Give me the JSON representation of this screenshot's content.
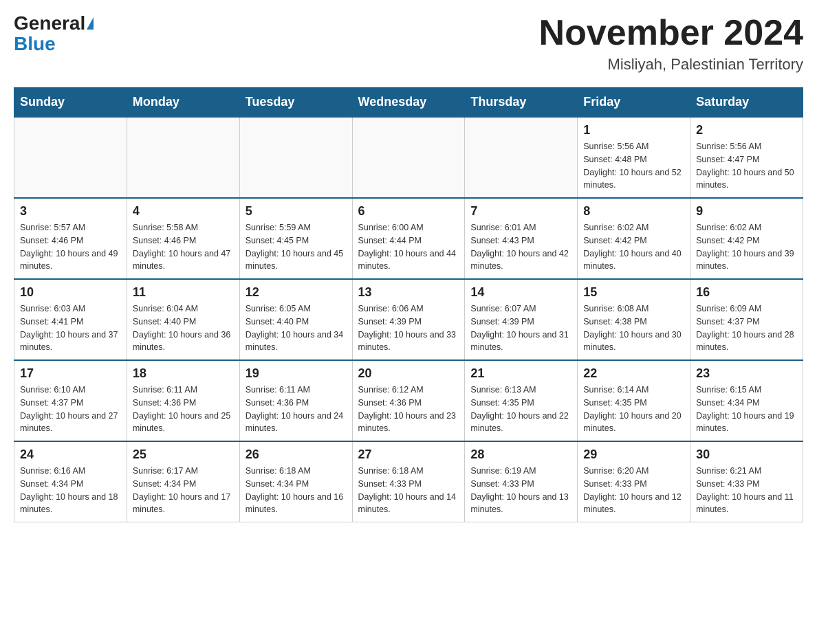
{
  "header": {
    "logo_general": "General",
    "logo_blue": "Blue",
    "title": "November 2024",
    "subtitle": "Misliyah, Palestinian Territory"
  },
  "calendar": {
    "days_of_week": [
      "Sunday",
      "Monday",
      "Tuesday",
      "Wednesday",
      "Thursday",
      "Friday",
      "Saturday"
    ],
    "weeks": [
      [
        {
          "day": "",
          "info": ""
        },
        {
          "day": "",
          "info": ""
        },
        {
          "day": "",
          "info": ""
        },
        {
          "day": "",
          "info": ""
        },
        {
          "day": "",
          "info": ""
        },
        {
          "day": "1",
          "info": "Sunrise: 5:56 AM\nSunset: 4:48 PM\nDaylight: 10 hours and 52 minutes."
        },
        {
          "day": "2",
          "info": "Sunrise: 5:56 AM\nSunset: 4:47 PM\nDaylight: 10 hours and 50 minutes."
        }
      ],
      [
        {
          "day": "3",
          "info": "Sunrise: 5:57 AM\nSunset: 4:46 PM\nDaylight: 10 hours and 49 minutes."
        },
        {
          "day": "4",
          "info": "Sunrise: 5:58 AM\nSunset: 4:46 PM\nDaylight: 10 hours and 47 minutes."
        },
        {
          "day": "5",
          "info": "Sunrise: 5:59 AM\nSunset: 4:45 PM\nDaylight: 10 hours and 45 minutes."
        },
        {
          "day": "6",
          "info": "Sunrise: 6:00 AM\nSunset: 4:44 PM\nDaylight: 10 hours and 44 minutes."
        },
        {
          "day": "7",
          "info": "Sunrise: 6:01 AM\nSunset: 4:43 PM\nDaylight: 10 hours and 42 minutes."
        },
        {
          "day": "8",
          "info": "Sunrise: 6:02 AM\nSunset: 4:42 PM\nDaylight: 10 hours and 40 minutes."
        },
        {
          "day": "9",
          "info": "Sunrise: 6:02 AM\nSunset: 4:42 PM\nDaylight: 10 hours and 39 minutes."
        }
      ],
      [
        {
          "day": "10",
          "info": "Sunrise: 6:03 AM\nSunset: 4:41 PM\nDaylight: 10 hours and 37 minutes."
        },
        {
          "day": "11",
          "info": "Sunrise: 6:04 AM\nSunset: 4:40 PM\nDaylight: 10 hours and 36 minutes."
        },
        {
          "day": "12",
          "info": "Sunrise: 6:05 AM\nSunset: 4:40 PM\nDaylight: 10 hours and 34 minutes."
        },
        {
          "day": "13",
          "info": "Sunrise: 6:06 AM\nSunset: 4:39 PM\nDaylight: 10 hours and 33 minutes."
        },
        {
          "day": "14",
          "info": "Sunrise: 6:07 AM\nSunset: 4:39 PM\nDaylight: 10 hours and 31 minutes."
        },
        {
          "day": "15",
          "info": "Sunrise: 6:08 AM\nSunset: 4:38 PM\nDaylight: 10 hours and 30 minutes."
        },
        {
          "day": "16",
          "info": "Sunrise: 6:09 AM\nSunset: 4:37 PM\nDaylight: 10 hours and 28 minutes."
        }
      ],
      [
        {
          "day": "17",
          "info": "Sunrise: 6:10 AM\nSunset: 4:37 PM\nDaylight: 10 hours and 27 minutes."
        },
        {
          "day": "18",
          "info": "Sunrise: 6:11 AM\nSunset: 4:36 PM\nDaylight: 10 hours and 25 minutes."
        },
        {
          "day": "19",
          "info": "Sunrise: 6:11 AM\nSunset: 4:36 PM\nDaylight: 10 hours and 24 minutes."
        },
        {
          "day": "20",
          "info": "Sunrise: 6:12 AM\nSunset: 4:36 PM\nDaylight: 10 hours and 23 minutes."
        },
        {
          "day": "21",
          "info": "Sunrise: 6:13 AM\nSunset: 4:35 PM\nDaylight: 10 hours and 22 minutes."
        },
        {
          "day": "22",
          "info": "Sunrise: 6:14 AM\nSunset: 4:35 PM\nDaylight: 10 hours and 20 minutes."
        },
        {
          "day": "23",
          "info": "Sunrise: 6:15 AM\nSunset: 4:34 PM\nDaylight: 10 hours and 19 minutes."
        }
      ],
      [
        {
          "day": "24",
          "info": "Sunrise: 6:16 AM\nSunset: 4:34 PM\nDaylight: 10 hours and 18 minutes."
        },
        {
          "day": "25",
          "info": "Sunrise: 6:17 AM\nSunset: 4:34 PM\nDaylight: 10 hours and 17 minutes."
        },
        {
          "day": "26",
          "info": "Sunrise: 6:18 AM\nSunset: 4:34 PM\nDaylight: 10 hours and 16 minutes."
        },
        {
          "day": "27",
          "info": "Sunrise: 6:18 AM\nSunset: 4:33 PM\nDaylight: 10 hours and 14 minutes."
        },
        {
          "day": "28",
          "info": "Sunrise: 6:19 AM\nSunset: 4:33 PM\nDaylight: 10 hours and 13 minutes."
        },
        {
          "day": "29",
          "info": "Sunrise: 6:20 AM\nSunset: 4:33 PM\nDaylight: 10 hours and 12 minutes."
        },
        {
          "day": "30",
          "info": "Sunrise: 6:21 AM\nSunset: 4:33 PM\nDaylight: 10 hours and 11 minutes."
        }
      ]
    ]
  }
}
